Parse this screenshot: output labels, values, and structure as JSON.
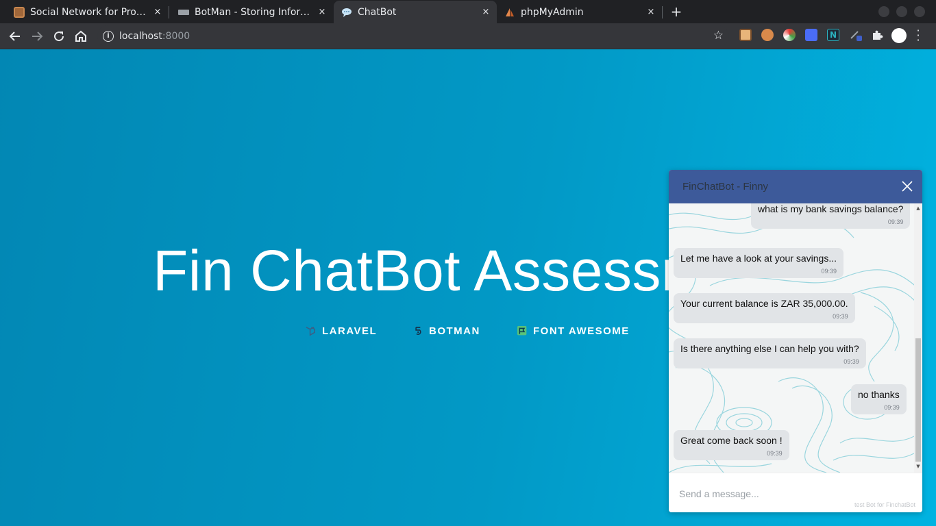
{
  "browser": {
    "tabs": [
      {
        "title": "Social Network for Programmers",
        "favicon": "box-favicon-icon",
        "close": "×",
        "active": false
      },
      {
        "title": "BotMan - Storing Information",
        "favicon": "keyboard-favicon-icon",
        "close": "×",
        "active": false
      },
      {
        "title": "ChatBot",
        "favicon": "chat-bubble-favicon-icon",
        "close": "×",
        "active": true
      },
      {
        "title": "phpMyAdmin",
        "favicon": "sailboat-favicon-icon",
        "close": "×",
        "active": false
      }
    ],
    "new_tab": "+",
    "address": {
      "host": "localhost",
      "port": ":8000"
    },
    "nav_icons": {
      "back": "arrow-back-icon",
      "forward": "arrow-forward-icon",
      "reload": "reload-icon",
      "home": "home-icon"
    },
    "star": "☆",
    "extensions": [
      "box-ext-icon",
      "face-ext-icon",
      "swirl-ext-icon",
      "link-ext-icon",
      "n-ext-icon",
      "pen-ext-icon",
      "puzzle-ext-icon"
    ]
  },
  "page": {
    "title": "Fin ChatBot Assessment",
    "links": [
      {
        "label": "LARAVEL",
        "icon": "laravel-icon"
      },
      {
        "label": "BOTMAN",
        "icon": "botman-icon"
      },
      {
        "label": "FONT AWESOME",
        "icon": "font-awesome-flag-icon"
      }
    ]
  },
  "chat": {
    "title": "FinChatBot - Finny",
    "messages": [
      {
        "from": "user",
        "text": "what is my bank savings balance?",
        "time": "09:39"
      },
      {
        "from": "bot",
        "text": "Let me have a look at your savings...",
        "time": "09:39"
      },
      {
        "from": "bot",
        "text": "Your current balance is ZAR 35,000.00.",
        "time": "09:39"
      },
      {
        "from": "bot",
        "text": "Is there anything else I can help you with?",
        "time": "09:39"
      },
      {
        "from": "user",
        "text": "no thanks",
        "time": "09:39"
      },
      {
        "from": "bot",
        "text": "Great come back soon !",
        "time": "09:39"
      }
    ],
    "input_placeholder": "Send a message...",
    "footer": "test Bot for FinchatBot"
  },
  "colors": {
    "page_gradient_start": "#0287b4",
    "page_gradient_end": "#01b3e1",
    "chat_header": "#3d5a9a",
    "bubble": "#e1e4e7",
    "topo_lines": "#7ccbd6"
  }
}
